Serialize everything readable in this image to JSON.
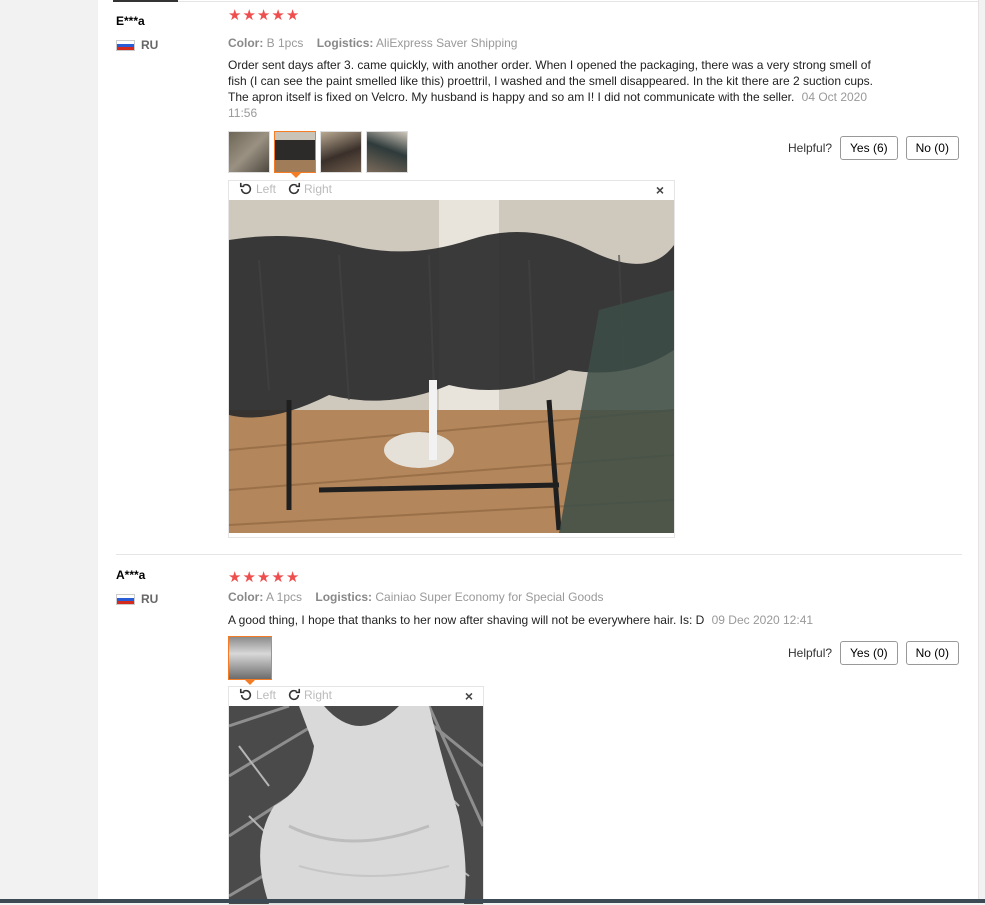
{
  "reviews": [
    {
      "user": "E***a",
      "country": "RU",
      "rating": 5,
      "color_label": "Color:",
      "color_value": "B 1pcs",
      "logistics_label": "Logistics:",
      "logistics_value": "AliExpress Saver Shipping",
      "text": "Order sent days after 3. came quickly, with another order. When I opened the packaging, there was a very strong smell of fish (I can see the paint smelled like this) proettril, I washed and the smell disappeared. In the kit there are 2 suction cups. The apron itself is fixed on Velcro. My husband is happy and so am I! I did not communicate with the seller.",
      "date": "04 Oct 2020 11:56",
      "helpful_label": "Helpful?",
      "yes_label": "Yes (6)",
      "no_label": "No (0)",
      "viewer": {
        "left_label": "Left",
        "right_label": "Right",
        "close_label": "×"
      }
    },
    {
      "user": "A***a",
      "country": "RU",
      "rating": 5,
      "color_label": "Color:",
      "color_value": "A 1pcs",
      "logistics_label": "Logistics:",
      "logistics_value": "Cainiao Super Economy for Special Goods",
      "text": "A good thing, I hope that thanks to her now after shaving will not be everywhere hair. Is: D",
      "date": "09 Dec 2020 12:41",
      "helpful_label": "Helpful?",
      "yes_label": "Yes (0)",
      "no_label": "No (0)",
      "viewer": {
        "left_label": "Left",
        "right_label": "Right",
        "close_label": "×"
      }
    }
  ],
  "colors": {
    "star": "#ef4e4e",
    "active_thumb": "#f37c24"
  }
}
